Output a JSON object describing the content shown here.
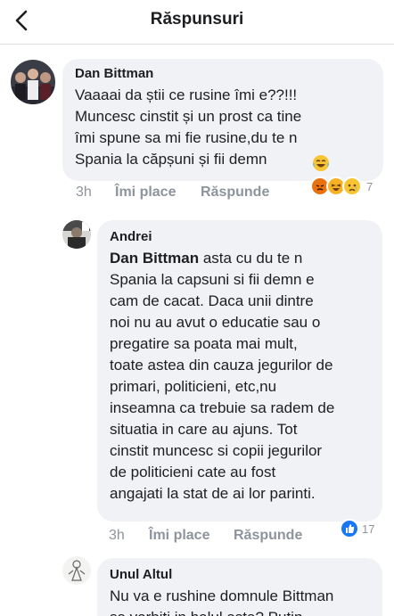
{
  "header": {
    "title": "Răspunsuri",
    "back_icon": "chevron-left-icon"
  },
  "comments": [
    {
      "author": "Dan Bittman",
      "text": "Vaaaai da știi ce rusine îmi e??!!!\nMuncesc cinstit și un prost ca tine\nîmi spune sa mi fie rusine,du te n\nSpania la căpșuni și fii demn",
      "emoji_icon": "tears-of-joy-emoji-icon",
      "time": "3h",
      "like_label": "Îmi place",
      "reply_label": "Răspunde",
      "reactions": {
        "icons": [
          "angry-icon",
          "haha-icon",
          "sad-icon"
        ],
        "count": "7"
      }
    },
    {
      "author": "Andrei",
      "mention": "Dan Bittman",
      "text_first": " asta cu du te n",
      "text": "Spania la capsuni si fii demn e\ncam de cacat. Daca unii dintre\nnoi nu au avut o educatie sau o\npregatire sa poata mai mult,\ntoate astea din cauza jegurilor de\nprimari, politicieni, etc,nu\ninseamna ca trebuie sa radem de\nsituatia in care au ajuns. Tot\ncinstit muncesc si copii jegurilor\nde politicieni cate au fost\nangajati la stat de ai lor parinti.",
      "time": "3h",
      "like_label": "Îmi place",
      "reply_label": "Răspunde",
      "reactions": {
        "icons": [
          "like-icon"
        ],
        "count": "17"
      }
    },
    {
      "author": "Unul Altul",
      "text": "Nu va e rushine domnule Bittman\nsa vorbiti in halul asta? Putin"
    }
  ],
  "colors": {
    "bubble": "#f1f2f5",
    "like_blue": "#1877f2",
    "angry": "#e9710f",
    "haha": "#f7b125",
    "meta": "#90949c"
  }
}
